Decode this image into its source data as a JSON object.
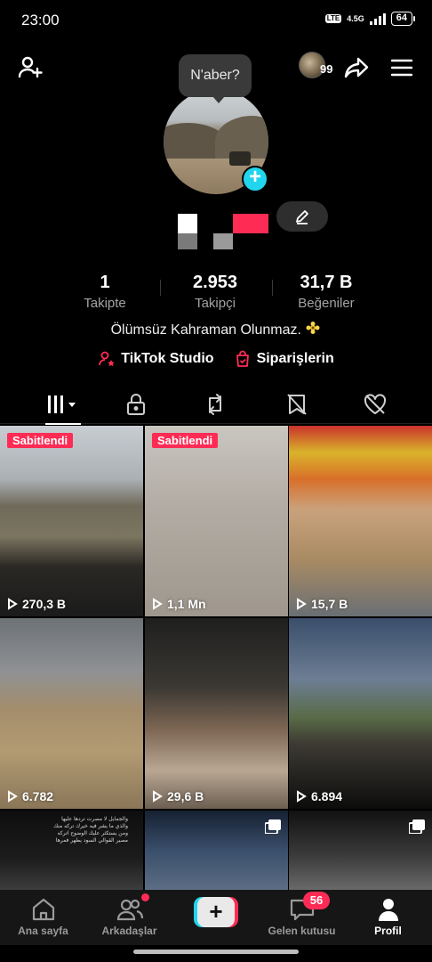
{
  "status_bar": {
    "time": "23:00",
    "volte": "Vo LTE",
    "network": "4.5G",
    "battery": "64"
  },
  "header": {
    "tooltip": "N'aber?",
    "visitor_count": "99"
  },
  "profile": {
    "stats": [
      {
        "value": "1",
        "label": "Takipte"
      },
      {
        "value": "2.953",
        "label": "Takipçi"
      },
      {
        "value": "31,7 B",
        "label": "Beğeniler"
      }
    ],
    "bio": "Ölümsüz Kahraman Olunmaz.",
    "links": [
      {
        "label": "TikTok Studio",
        "icon": "person-star-icon"
      },
      {
        "label": "Siparişlerin",
        "icon": "shopping-bag-icon"
      }
    ]
  },
  "tabs": [
    {
      "icon": "grid-icon",
      "active": true
    },
    {
      "icon": "lock-icon",
      "active": false
    },
    {
      "icon": "repost-icon",
      "active": false
    },
    {
      "icon": "bookmark-hidden-icon",
      "active": false
    },
    {
      "icon": "heart-hidden-icon",
      "active": false
    }
  ],
  "videos": [
    {
      "views": "270,3 B",
      "pinned": "Sabitlendi"
    },
    {
      "views": "1,1 Mn",
      "pinned": "Sabitlendi"
    },
    {
      "views": "15,7 B"
    },
    {
      "views": "6.782"
    },
    {
      "views": "29,6 B"
    },
    {
      "views": "6.894"
    },
    {
      "views": "",
      "overlay_text": "والجمايل لا مصرت تردها عليها\nوالذي ما يشر فيه خيرك تركه منك\nومن يستكثر عليك الوضوح اتركه\nمصير القوالي السود يطهر فمرها"
    },
    {
      "views": ""
    },
    {
      "views": ""
    }
  ],
  "bottom_nav": [
    {
      "label": "Ana sayfa",
      "icon": "home-icon"
    },
    {
      "label": "Arkadaşlar",
      "icon": "friends-icon"
    },
    {
      "label": "",
      "icon": "plus-icon"
    },
    {
      "label": "Gelen kutusu",
      "icon": "inbox-icon",
      "badge": "56"
    },
    {
      "label": "Profil",
      "icon": "profile-icon",
      "active": true
    }
  ],
  "colors": {
    "accent": "#fe2c55",
    "cyan": "#20d5ec",
    "background": "#000000"
  }
}
